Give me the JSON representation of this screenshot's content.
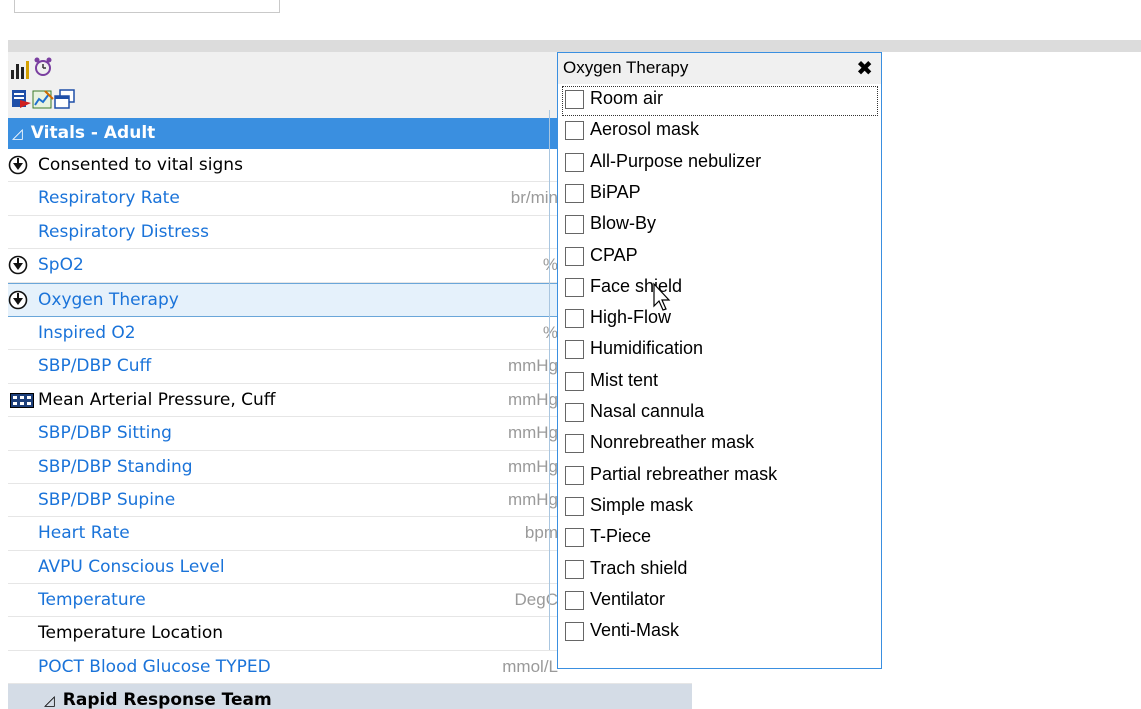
{
  "main": {
    "rows": [
      {
        "type": "section",
        "label": "Vitals - Adult"
      },
      {
        "type": "item",
        "label": "Consented to vital signs",
        "color": "black",
        "icon": "expand-circle-icon",
        "unit": ""
      },
      {
        "type": "item",
        "label": "Respiratory Rate",
        "color": "blue",
        "icon": "",
        "unit": "br/min"
      },
      {
        "type": "item",
        "label": "Respiratory Distress",
        "color": "blue",
        "icon": "",
        "unit": ""
      },
      {
        "type": "item",
        "label": "SpO2",
        "color": "blue",
        "icon": "expand-circle-icon",
        "unit": "%"
      },
      {
        "type": "item",
        "label": "Oxygen Therapy",
        "color": "blue",
        "icon": "expand-circle-icon",
        "unit": "",
        "selected": true
      },
      {
        "type": "item",
        "label": "Inspired O2",
        "color": "blue",
        "icon": "",
        "unit": "%"
      },
      {
        "type": "item",
        "label": "SBP/DBP Cuff",
        "color": "blue",
        "icon": "",
        "unit": "mmHg"
      },
      {
        "type": "item",
        "label": "Mean Arterial Pressure, Cuff",
        "color": "black",
        "icon": "calculator-icon",
        "unit": "mmHg"
      },
      {
        "type": "item",
        "label": "SBP/DBP Sitting",
        "color": "blue",
        "icon": "",
        "unit": "mmHg"
      },
      {
        "type": "item",
        "label": "SBP/DBP Standing",
        "color": "blue",
        "icon": "",
        "unit": "mmHg"
      },
      {
        "type": "item",
        "label": "SBP/DBP Supine",
        "color": "blue",
        "icon": "",
        "unit": "mmHg"
      },
      {
        "type": "item",
        "label": "Heart Rate",
        "color": "blue",
        "icon": "",
        "unit": "bpm"
      },
      {
        "type": "item",
        "label": "AVPU Conscious Level",
        "color": "blue",
        "icon": "",
        "unit": ""
      },
      {
        "type": "item",
        "label": "Temperature",
        "color": "blue",
        "icon": "",
        "unit": "DegC"
      },
      {
        "type": "item",
        "label": "Temperature Location",
        "color": "black",
        "icon": "",
        "unit": ""
      },
      {
        "type": "item",
        "label": "POCT Blood Glucose TYPED",
        "color": "blue",
        "icon": "",
        "unit": "mmol/L"
      },
      {
        "type": "subsection",
        "label": "Rapid Response Team"
      }
    ]
  },
  "popup": {
    "title": "Oxygen Therapy",
    "close": "✖",
    "options": [
      "Room air",
      "Aerosol mask",
      "All-Purpose nebulizer",
      "BiPAP",
      "Blow-By",
      "CPAP",
      "Face shield",
      "High-Flow",
      "Humidification",
      "Mist tent",
      "Nasal cannula",
      "Nonrebreather mask",
      "Partial rebreather mask",
      "Simple mask",
      "T-Piece",
      "Trach shield",
      "Ventilator",
      "Venti-Mask"
    ]
  },
  "colors": {
    "accent": "#3a8fe0",
    "link": "#1a73d9",
    "unit": "#9a9a9a"
  }
}
